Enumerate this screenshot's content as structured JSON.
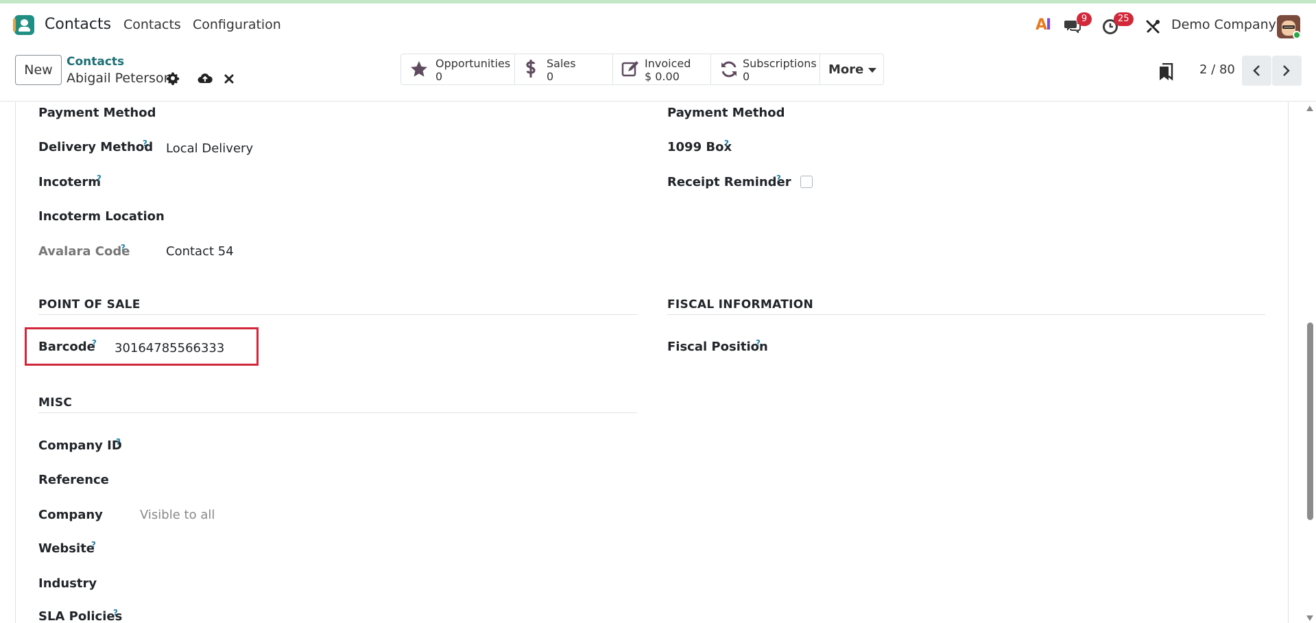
{
  "navbar": {
    "app_name": "Contacts",
    "menu": [
      "Contacts",
      "Configuration"
    ],
    "messages_count": "9",
    "activities_count": "25",
    "company": "Demo Company"
  },
  "control": {
    "new_label": "New",
    "breadcrumb_parent": "Contacts",
    "record_name": "Abigail Peterson",
    "pager": "2 / 80",
    "more_label": "More",
    "stats": [
      {
        "label": "Opportunities",
        "value": "0",
        "icon": "star-icon"
      },
      {
        "label": "Sales",
        "value": "0",
        "icon": "dollar-icon"
      },
      {
        "label": "Invoiced",
        "value": "$ 0.00",
        "icon": "edit-icon"
      },
      {
        "label": "Subscriptions",
        "value": "0",
        "icon": "refresh-icon"
      }
    ]
  },
  "form": {
    "left": {
      "payment_method": {
        "label": "Payment Method"
      },
      "delivery_method": {
        "label": "Delivery Method",
        "help": "?",
        "value": "Local Delivery"
      },
      "incoterm": {
        "label": "Incoterm",
        "help": "?"
      },
      "incoterm_location": {
        "label": "Incoterm Location"
      },
      "avalara_code": {
        "label": "Avalara Code",
        "help": "?",
        "value": "Contact 54"
      }
    },
    "right": {
      "payment_method": {
        "label": "Payment Method"
      },
      "box_1099": {
        "label": "1099 Box",
        "help": "?"
      },
      "receipt_reminder": {
        "label": "Receipt Reminder",
        "help": "?"
      }
    },
    "pos": {
      "title": "POINT OF SALE",
      "barcode": {
        "label": "Barcode",
        "help": "?",
        "value": "30164785566333"
      }
    },
    "fiscal": {
      "title": "FISCAL INFORMATION",
      "fiscal_position": {
        "label": "Fiscal Position",
        "help": "?"
      }
    },
    "misc": {
      "title": "MISC",
      "company_id": {
        "label": "Company ID",
        "help": "?"
      },
      "reference": {
        "label": "Reference"
      },
      "company": {
        "label": "Company",
        "placeholder": "Visible to all"
      },
      "website": {
        "label": "Website",
        "help": "?"
      },
      "industry": {
        "label": "Industry"
      },
      "sla_policies": {
        "label": "SLA Policies",
        "help": "?"
      }
    }
  },
  "colors": {
    "brand_teal": "#1d6f74",
    "badge_red": "#d2283a",
    "highlight_red": "#d0263a",
    "help_blue": "#1f7ea8"
  }
}
